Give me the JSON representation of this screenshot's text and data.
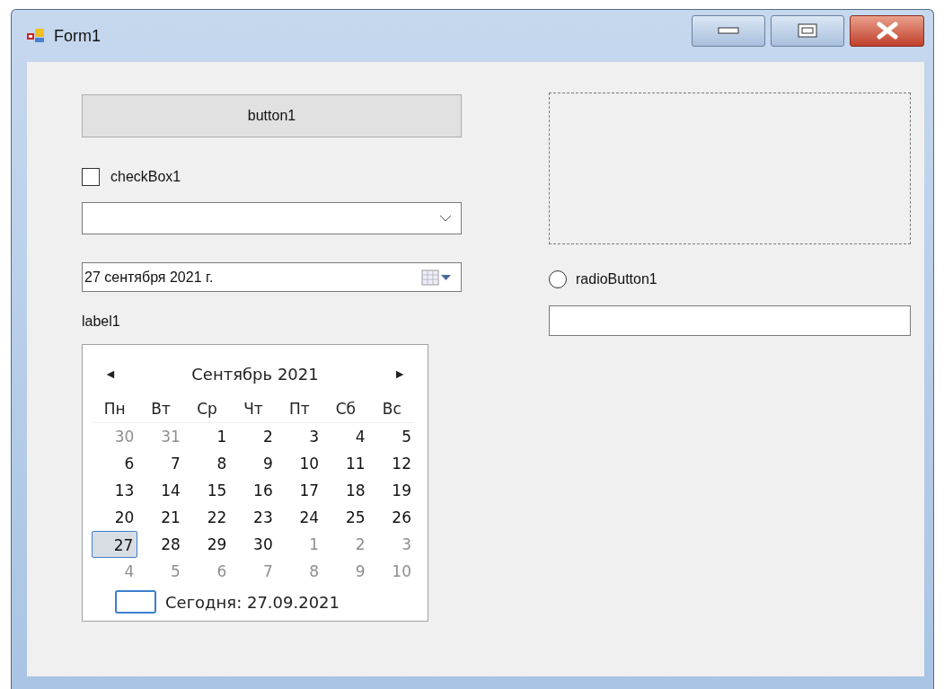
{
  "window": {
    "title": "Form1"
  },
  "button": {
    "label": "button1"
  },
  "checkbox": {
    "label": "checkBox1",
    "checked": false
  },
  "date_picker": {
    "value": "27 сентября 2021 г."
  },
  "label": {
    "text": "label1"
  },
  "calendar": {
    "prev": "◄",
    "title": "Сентябрь 2021",
    "next": "►",
    "weekdays": [
      "Пн",
      "Вт",
      "Ср",
      "Чт",
      "Пт",
      "Сб",
      "Вс"
    ],
    "weeks": [
      [
        {
          "day": "30",
          "other_month": true,
          "selected": false
        },
        {
          "day": "31",
          "other_month": true,
          "selected": false
        },
        {
          "day": "1",
          "other_month": false,
          "selected": false
        },
        {
          "day": "2",
          "other_month": false,
          "selected": false
        },
        {
          "day": "3",
          "other_month": false,
          "selected": false
        },
        {
          "day": "4",
          "other_month": false,
          "selected": false
        },
        {
          "day": "5",
          "other_month": false,
          "selected": false
        }
      ],
      [
        {
          "day": "6",
          "other_month": false,
          "selected": false
        },
        {
          "day": "7",
          "other_month": false,
          "selected": false
        },
        {
          "day": "8",
          "other_month": false,
          "selected": false
        },
        {
          "day": "9",
          "other_month": false,
          "selected": false
        },
        {
          "day": "10",
          "other_month": false,
          "selected": false
        },
        {
          "day": "11",
          "other_month": false,
          "selected": false
        },
        {
          "day": "12",
          "other_month": false,
          "selected": false
        }
      ],
      [
        {
          "day": "13",
          "other_month": false,
          "selected": false
        },
        {
          "day": "14",
          "other_month": false,
          "selected": false
        },
        {
          "day": "15",
          "other_month": false,
          "selected": false
        },
        {
          "day": "16",
          "other_month": false,
          "selected": false
        },
        {
          "day": "17",
          "other_month": false,
          "selected": false
        },
        {
          "day": "18",
          "other_month": false,
          "selected": false
        },
        {
          "day": "19",
          "other_month": false,
          "selected": false
        }
      ],
      [
        {
          "day": "20",
          "other_month": false,
          "selected": false
        },
        {
          "day": "21",
          "other_month": false,
          "selected": false
        },
        {
          "day": "22",
          "other_month": false,
          "selected": false
        },
        {
          "day": "23",
          "other_month": false,
          "selected": false
        },
        {
          "day": "24",
          "other_month": false,
          "selected": false
        },
        {
          "day": "25",
          "other_month": false,
          "selected": false
        },
        {
          "day": "26",
          "other_month": false,
          "selected": false
        }
      ],
      [
        {
          "day": "27",
          "other_month": false,
          "selected": true
        },
        {
          "day": "28",
          "other_month": false,
          "selected": false
        },
        {
          "day": "29",
          "other_month": false,
          "selected": false
        },
        {
          "day": "30",
          "other_month": false,
          "selected": false
        },
        {
          "day": "1",
          "other_month": true,
          "selected": false
        },
        {
          "day": "2",
          "other_month": true,
          "selected": false
        },
        {
          "day": "3",
          "other_month": true,
          "selected": false
        }
      ],
      [
        {
          "day": "4",
          "other_month": true,
          "selected": false
        },
        {
          "day": "5",
          "other_month": true,
          "selected": false
        },
        {
          "day": "6",
          "other_month": true,
          "selected": false
        },
        {
          "day": "7",
          "other_month": true,
          "selected": false
        },
        {
          "day": "8",
          "other_month": true,
          "selected": false
        },
        {
          "day": "9",
          "other_month": true,
          "selected": false
        },
        {
          "day": "10",
          "other_month": true,
          "selected": false
        }
      ]
    ],
    "today": "Сегодня: 27.09.2021"
  },
  "radio": {
    "label": "radioButton1",
    "selected": false
  }
}
